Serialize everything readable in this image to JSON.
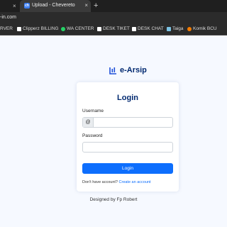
{
  "browser": {
    "active_tab_title": "Upload - Chevereto",
    "active_tab_favicon": "ch",
    "new_tab_symbol": "+",
    "close_symbol": "×",
    "url": "-in.com",
    "bookmarks": [
      {
        "label": "RVER",
        "color": "#9e9e9e"
      },
      {
        "label": "Clipperz BILLING",
        "color": "#ffffff"
      },
      {
        "label": "WA CENTER",
        "color": "#25d366"
      },
      {
        "label": "DESK TIKET",
        "color": "#ffffff"
      },
      {
        "label": "DESK CHAT",
        "color": "#ffffff"
      },
      {
        "label": "Taiga",
        "color": "#7cc4e5"
      },
      {
        "label": "Komik BCU",
        "color": "#f57c00"
      }
    ]
  },
  "brand": {
    "name": "e-Arsip"
  },
  "login": {
    "title": "Login",
    "username_label": "Username",
    "username_prefix": "@",
    "password_label": "Password",
    "button_label": "Login",
    "signup_prompt": "Don't have account?",
    "signup_link": "Create an account"
  },
  "footer": {
    "credits": "Designed by Fp Robert"
  },
  "colors": {
    "accent": "#0d6efd",
    "brand": "#012970",
    "background": "#f6f9ff"
  }
}
